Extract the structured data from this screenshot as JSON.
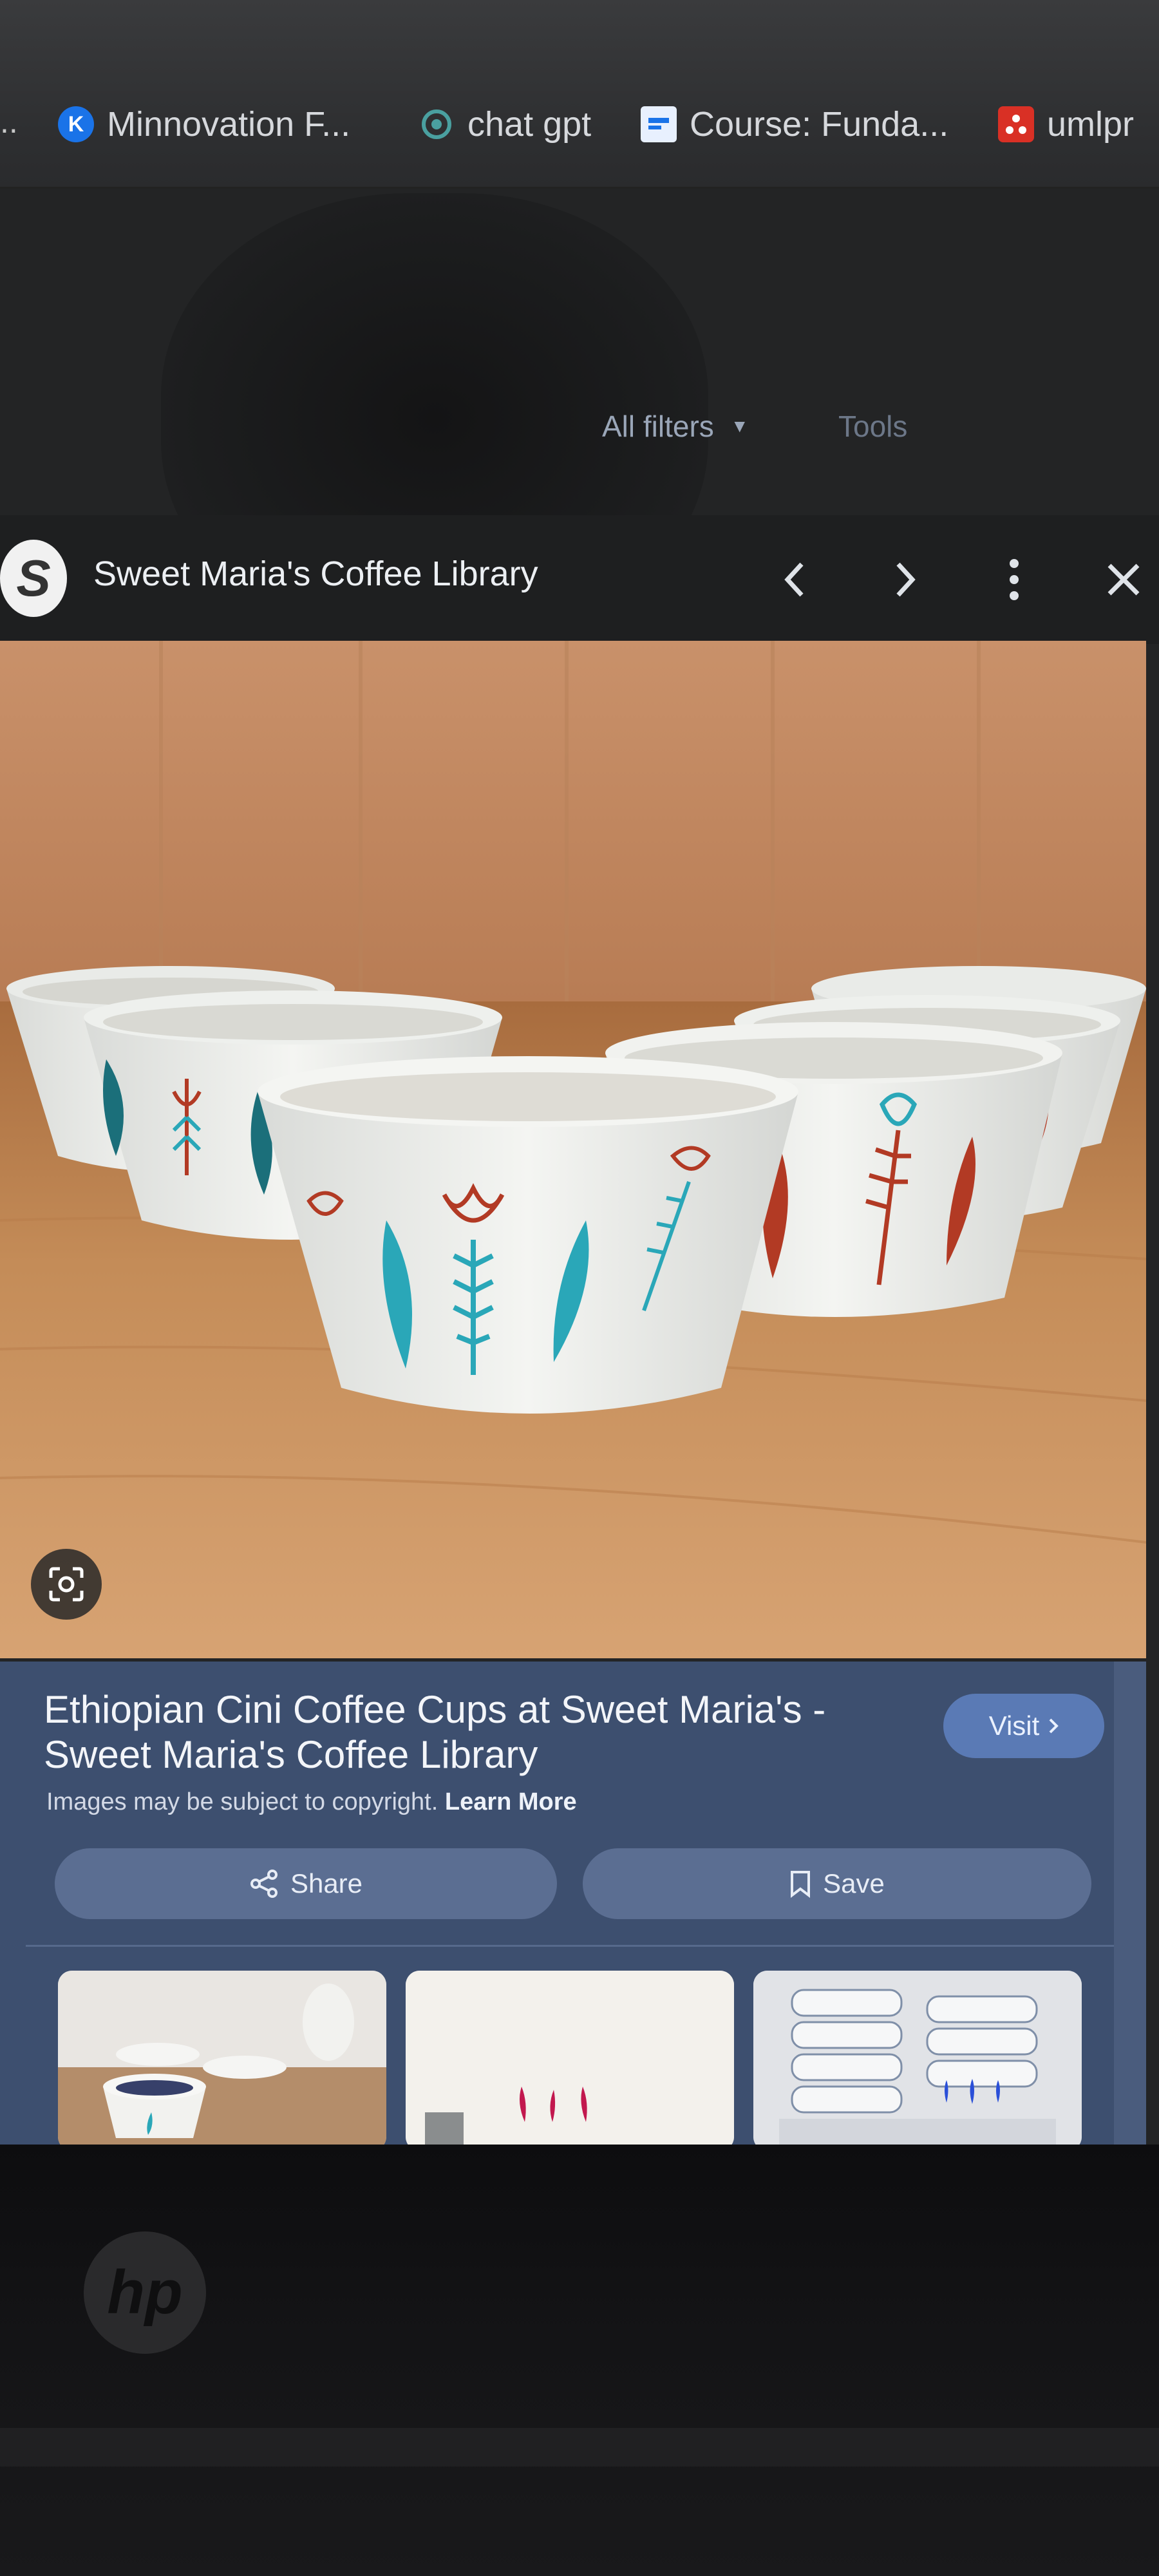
{
  "bookmarks_bar": {
    "overflow_label": "..",
    "items": [
      {
        "label": "Minnovation F...",
        "icon_text": "K",
        "icon_color": "#1a73e8"
      },
      {
        "label": "chat gpt",
        "icon": "openai-icon",
        "icon_color": "#4aa0a0"
      },
      {
        "label": "Course: Funda...",
        "icon": "course-icon",
        "icon_color": "#e8f0fe"
      },
      {
        "label": "umlpr",
        "icon": "app-icon",
        "icon_color": "#d93025"
      }
    ]
  },
  "search_tools": {
    "all_filters_label": "All filters",
    "tools_label": "Tools"
  },
  "viewer": {
    "source_logo_text": "S",
    "source_name": "Sweet Maria's Coffee Library",
    "prev_icon": "chevron-left-icon",
    "next_icon": "chevron-right-icon",
    "more_icon": "more-vert-icon",
    "close_icon": "close-icon"
  },
  "result": {
    "title": "Ethiopian Cini Coffee Cups at Sweet Maria's - Sweet Maria's Coffee Library",
    "visit_label": "Visit",
    "copyright_text": "Images may be subject to copyright.",
    "learn_more_label": "Learn More",
    "share_label": "Share",
    "save_label": "Save"
  },
  "colors": {
    "panel_bg": "#3d4f6f",
    "visit_bg": "#5a7ab5",
    "pill_bg": "#5b6e92",
    "cup_teal": "#2aa7b8",
    "cup_red": "#b23a24",
    "wood": "#c98f5c"
  }
}
